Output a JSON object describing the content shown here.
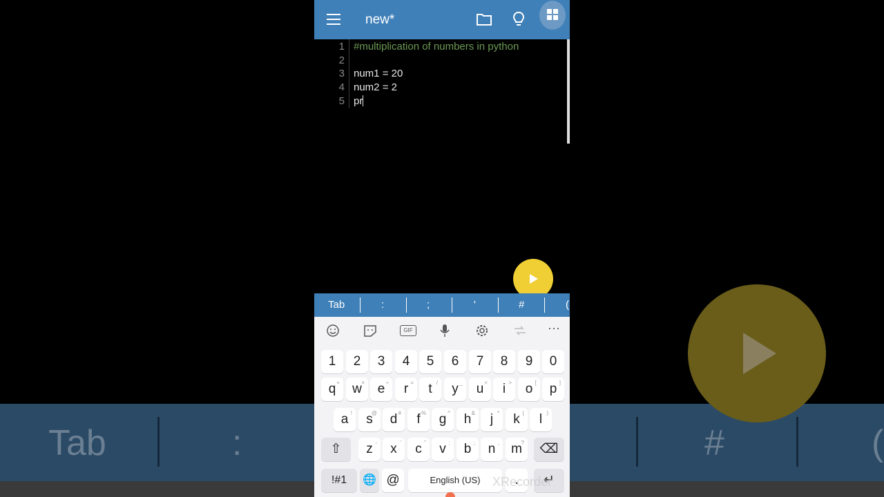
{
  "app": {
    "title": "new*"
  },
  "editor": {
    "lines": [
      {
        "num": "1",
        "text": "#multiplication of numbers in python",
        "type": "comment"
      },
      {
        "num": "2",
        "text": "",
        "type": "code"
      },
      {
        "num": "3",
        "text": "num1 = 20",
        "type": "code"
      },
      {
        "num": "4",
        "text": "num2 = 2",
        "type": "code"
      },
      {
        "num": "5",
        "text": "pr",
        "type": "code"
      }
    ]
  },
  "extra_keys": [
    "Tab",
    ":",
    ";",
    "'",
    "#",
    "("
  ],
  "keyboard": {
    "tools": [
      "emoji-icon",
      "sticker-icon",
      "gif-icon",
      "microphone-icon",
      "settings-icon",
      "translate-icon",
      "more-icon"
    ],
    "gif_label": "GIF",
    "more_label": "···",
    "numbers": [
      "1",
      "2",
      "3",
      "4",
      "5",
      "6",
      "7",
      "8",
      "9",
      "0"
    ],
    "row1": [
      {
        "k": "q",
        "h": "+"
      },
      {
        "k": "w",
        "h": "×"
      },
      {
        "k": "e",
        "h": "÷"
      },
      {
        "k": "r",
        "h": "="
      },
      {
        "k": "t",
        "h": "/"
      },
      {
        "k": "y",
        "h": "_"
      },
      {
        "k": "u",
        "h": "<"
      },
      {
        "k": "i",
        "h": ">"
      },
      {
        "k": "o",
        "h": "["
      },
      {
        "k": "p",
        "h": "]"
      }
    ],
    "row2": [
      {
        "k": "a",
        "h": "!"
      },
      {
        "k": "s",
        "h": "@"
      },
      {
        "k": "d",
        "h": "#"
      },
      {
        "k": "f",
        "h": "%"
      },
      {
        "k": "g",
        "h": "^"
      },
      {
        "k": "h",
        "h": "&"
      },
      {
        "k": "j",
        "h": "*"
      },
      {
        "k": "k",
        "h": "("
      },
      {
        "k": "l",
        "h": ")"
      }
    ],
    "row3": [
      {
        "k": "z",
        "h": "-"
      },
      {
        "k": "x",
        "h": "'"
      },
      {
        "k": "c",
        "h": "\""
      },
      {
        "k": "v",
        "h": ":"
      },
      {
        "k": "b",
        "h": ";"
      },
      {
        "k": "n",
        "h": ","
      },
      {
        "k": "m",
        "h": "?"
      }
    ],
    "symbols_label": "!#1",
    "at_label": "@",
    "space_label": "English (US)",
    "period_label": ".",
    "shift_icon": "⇧",
    "backspace_icon": "⌫",
    "globe_icon": "🌐",
    "enter_icon": "↵"
  },
  "watermark": "XRecorder",
  "background_echo": {
    "tab": "Tab",
    "colon": ":",
    "hash": "#",
    "paren": "("
  },
  "colors": {
    "appbar": "#3f80b8",
    "comment": "#6a9955",
    "fab": "#f0cf35"
  }
}
